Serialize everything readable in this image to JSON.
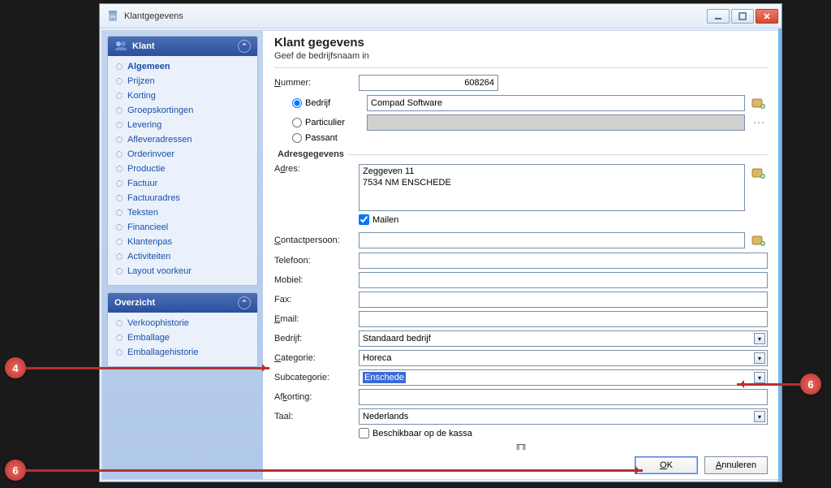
{
  "window": {
    "title": "Klantgegevens"
  },
  "sidebar": {
    "panels": [
      {
        "title": "Klant",
        "items": [
          {
            "label": "Algemeen",
            "active": true
          },
          {
            "label": "Prijzen"
          },
          {
            "label": "Korting"
          },
          {
            "label": "Groepskortingen"
          },
          {
            "label": "Levering"
          },
          {
            "label": "Afleveradressen"
          },
          {
            "label": "Orderinvoer"
          },
          {
            "label": "Productie"
          },
          {
            "label": "Factuur"
          },
          {
            "label": "Factuuradres"
          },
          {
            "label": "Teksten"
          },
          {
            "label": "Financieel"
          },
          {
            "label": "Klantenpas"
          },
          {
            "label": "Activiteiten"
          },
          {
            "label": "Layout voorkeur"
          }
        ]
      },
      {
        "title": "Overzicht",
        "items": [
          {
            "label": "Verkoophistorie"
          },
          {
            "label": "Emballage"
          },
          {
            "label": "Emballagehistorie"
          }
        ]
      }
    ]
  },
  "main": {
    "title": "Klant gegevens",
    "subtitle": "Geef de bedrijfsnaam in",
    "nummer_label": "Nummer:",
    "nummer_value": "608264",
    "type": {
      "bedrijf_label": "Bedrijf",
      "particulier_label": "Particulier",
      "passant_label": "Passant",
      "selected": "bedrijf",
      "bedrijf_value": "Compad Software",
      "particulier_value": ""
    },
    "adres_section": "Adresgegevens",
    "adres_label": "Adres:",
    "adres_value": "Zeggeven 11\n7534 NM  ENSCHEDE",
    "mailen_label": "Mailen",
    "mailen_checked": true,
    "contact_label": "Contactpersoon:",
    "contact_value": "",
    "telefoon_label": "Telefoon:",
    "telefoon_value": "",
    "mobiel_label": "Mobiel:",
    "mobiel_value": "",
    "fax_label": "Fax:",
    "fax_value": "",
    "email_label": "Email:",
    "email_value": "",
    "bedrijf_label": "Bedrijf:",
    "bedrijf_sel": "Standaard bedrijf",
    "categorie_label": "Categorie:",
    "categorie_sel": "Horeca",
    "subcategorie_label": "Subcategorie:",
    "subcategorie_sel": "Enschede",
    "afkorting_label": "Afkorting:",
    "afkorting_value": "",
    "taal_label": "Taal:",
    "taal_sel": "Nederlands",
    "kassa_label": "Beschikbaar op de kassa",
    "kassa_checked": false,
    "ok_label": "OK",
    "cancel_label": "Annuleren"
  },
  "callouts": {
    "c4": "4",
    "c6a": "6",
    "c6b": "6"
  }
}
